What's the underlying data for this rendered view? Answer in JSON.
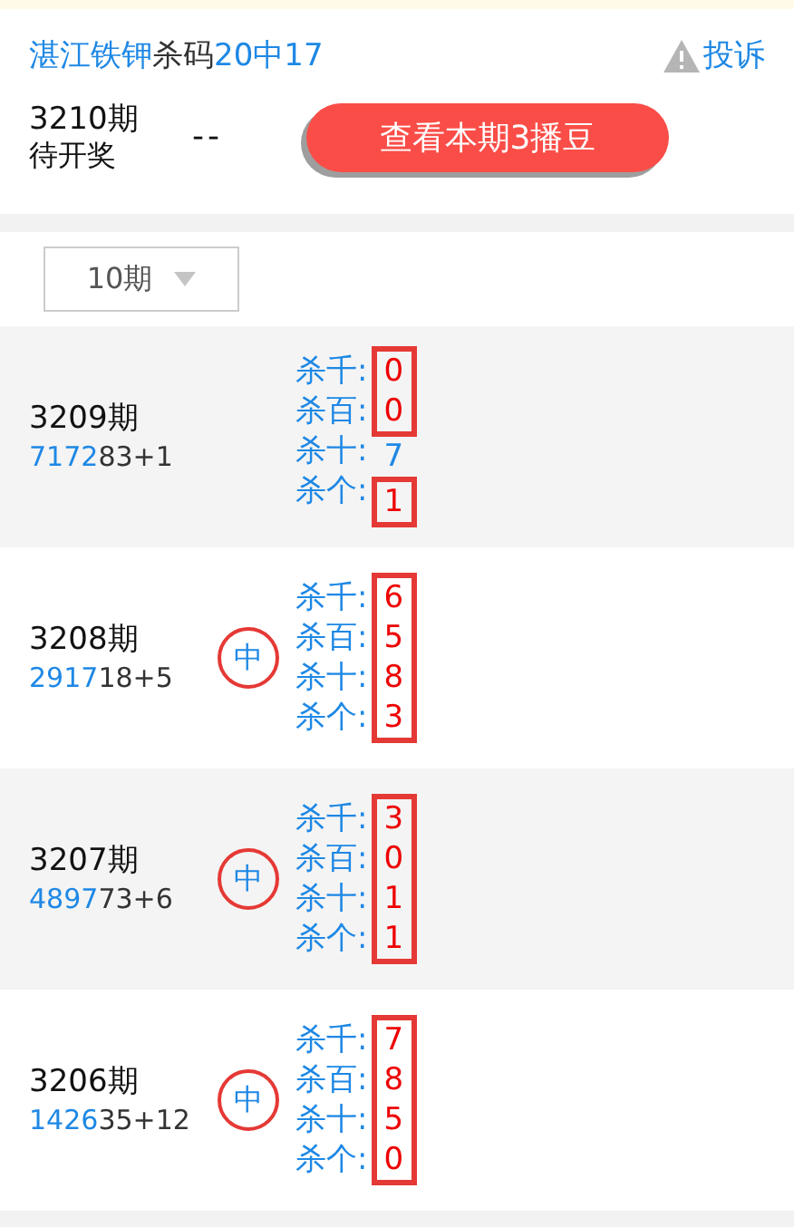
{
  "header": {
    "title_parts": [
      {
        "text": "湛江铁钾",
        "kind": "accent"
      },
      {
        "text": "杀码",
        "kind": "plain"
      },
      {
        "text": "20中17",
        "kind": "accent"
      }
    ],
    "complaint": "投诉"
  },
  "current": {
    "period": "3210期",
    "status": "待开奖",
    "result": "--",
    "button": "查看本期3播豆"
  },
  "filter": {
    "value": "10期"
  },
  "rows": [
    {
      "period": "3209期",
      "draw_head": "7172",
      "draw_tail": "83+1",
      "hit": false,
      "kills": [
        {
          "label": "杀千:",
          "value": "0",
          "boxed": true
        },
        {
          "label": "杀百:",
          "value": "0",
          "boxed": true
        },
        {
          "label": "杀十:",
          "value": "7",
          "boxed": false
        },
        {
          "label": "杀个:",
          "value": "1",
          "boxed": true
        }
      ]
    },
    {
      "period": "3208期",
      "draw_head": "2917",
      "draw_tail": "18+5",
      "hit": true,
      "hit_label": "中",
      "kills": [
        {
          "label": "杀千:",
          "value": "6",
          "boxed": true
        },
        {
          "label": "杀百:",
          "value": "5",
          "boxed": true
        },
        {
          "label": "杀十:",
          "value": "8",
          "boxed": true
        },
        {
          "label": "杀个:",
          "value": "3",
          "boxed": true
        }
      ]
    },
    {
      "period": "3207期",
      "draw_head": "4897",
      "draw_tail": "73+6",
      "hit": true,
      "hit_label": "中",
      "kills": [
        {
          "label": "杀千:",
          "value": "3",
          "boxed": true
        },
        {
          "label": "杀百:",
          "value": "0",
          "boxed": true
        },
        {
          "label": "杀十:",
          "value": "1",
          "boxed": true
        },
        {
          "label": "杀个:",
          "value": "1",
          "boxed": true
        }
      ]
    },
    {
      "period": "3206期",
      "draw_head": "1426",
      "draw_tail": "35+12",
      "hit": true,
      "hit_label": "中",
      "kills": [
        {
          "label": "杀千:",
          "value": "7",
          "boxed": true
        },
        {
          "label": "杀百:",
          "value": "8",
          "boxed": true
        },
        {
          "label": "杀十:",
          "value": "5",
          "boxed": true
        },
        {
          "label": "杀个:",
          "value": "0",
          "boxed": true
        }
      ]
    }
  ]
}
